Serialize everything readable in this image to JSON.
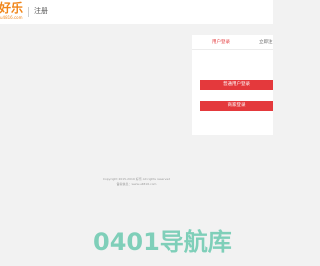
{
  "header": {
    "logo_text": "好乐",
    "logo_sub": "u4816.com",
    "page_label": "注册"
  },
  "login_card": {
    "tabs": [
      "用户登录",
      "立即注"
    ],
    "user_login_button": "普通用户登录",
    "merchant_login_button": "商家登录"
  },
  "footer": {
    "copyright": "Copyright 2015-2019 好乐 All rights reserved",
    "record": "备案信息：www.u4816.com"
  },
  "watermark": "0401导航库",
  "colors": {
    "accent": "#e4393c",
    "logo": "#f08519",
    "watermark": "#22b38c"
  }
}
